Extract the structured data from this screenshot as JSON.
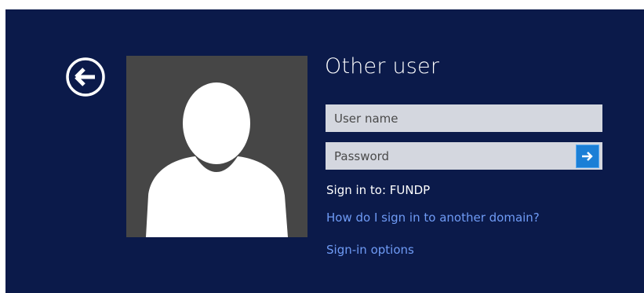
{
  "title": "Other user",
  "username_field": {
    "placeholder": "User name",
    "value": ""
  },
  "password_field": {
    "placeholder": "Password",
    "value": ""
  },
  "sign_in_to": "Sign in to: FUNDP",
  "help_link": "How do I sign in to another domain?",
  "options_link": "Sign-in options",
  "icons": {
    "back": "back-arrow-icon",
    "submit": "arrow-right-icon",
    "avatar": "user-silhouette-icon"
  },
  "colors": {
    "background": "#0b1a4a",
    "avatar_bg": "#464646",
    "field_bg": "#d4d7df",
    "submit_bg": "#1b7fd6",
    "link": "#6f9bf5"
  }
}
